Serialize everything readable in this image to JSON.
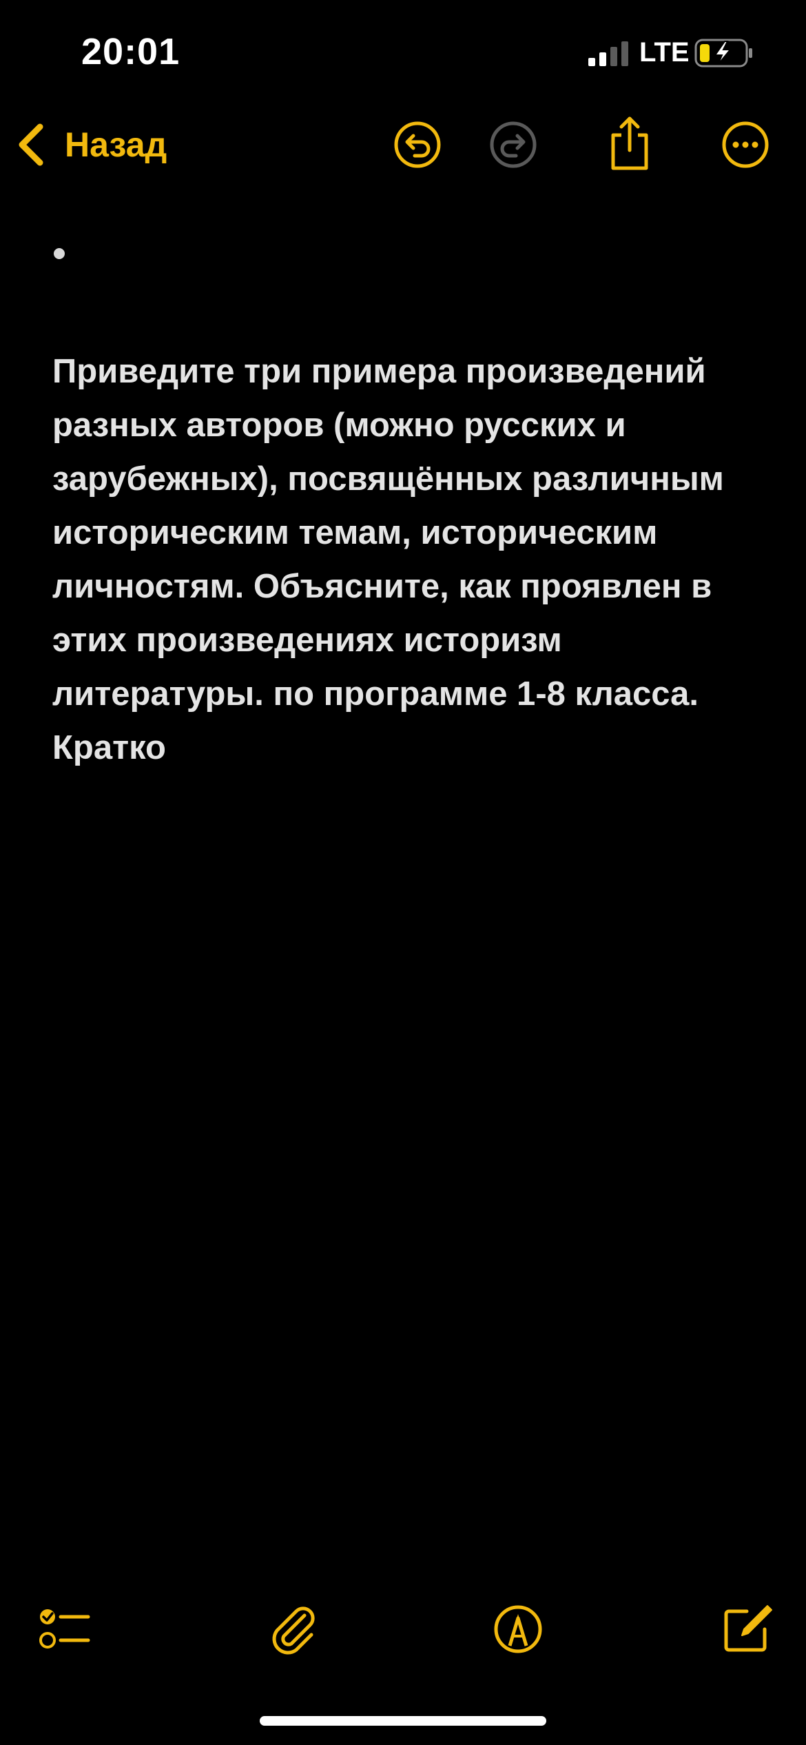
{
  "status_bar": {
    "time": "20:01",
    "network": "LTE",
    "signal_icon": "cellular-signal-icon",
    "battery_icon": "battery-charging-icon"
  },
  "nav": {
    "back_label": "Назад",
    "icons": [
      "undo-icon",
      "redo-icon",
      "share-icon",
      "more-icon"
    ]
  },
  "note": {
    "text": "Приведите три примера произведений разных авторов (можно русских и зарубежных), посвящённых различным историческим темам, историческим личностям. Объясните, как проявлен в этих произведениях историзм литературы. по программе 1-8 класса. Кратко"
  },
  "toolbar": {
    "icons": [
      "checklist-icon",
      "attachment-icon",
      "markup-icon",
      "compose-icon"
    ]
  },
  "colors": {
    "accent": "#f2b90e",
    "background": "#000000",
    "text": "#e4e4e4",
    "disabled": "#5a5a5a"
  }
}
